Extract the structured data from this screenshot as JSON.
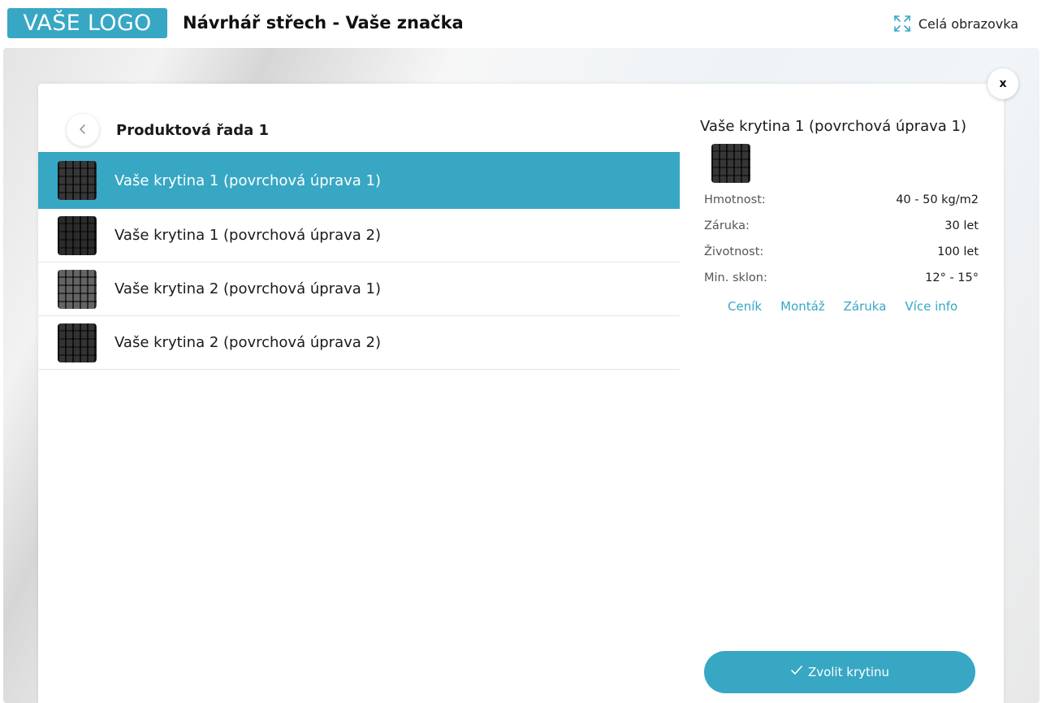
{
  "header": {
    "logo_text": "VAŠE LOGO",
    "app_title": "Návrhář střech - Vaše značka",
    "fullscreen_label": "Celá obrazovka"
  },
  "panel": {
    "close_label": "x",
    "series_title": "Produktová řada 1"
  },
  "products": [
    {
      "name": "Vaše krytina 1 (povrchová úprava 1)",
      "selected": true
    },
    {
      "name": "Vaše krytina 1 (povrchová úprava 2)",
      "selected": false
    },
    {
      "name": "Vaše krytina 2 (povrchová úprava 1)",
      "selected": false
    },
    {
      "name": "Vaše krytina 2 (povrchová úprava 2)",
      "selected": false
    }
  ],
  "detail": {
    "title": "Vaše krytina 1 (povrchová úprava 1)",
    "properties": [
      {
        "label": "Hmotnost:",
        "value": "40 - 50 kg/m2"
      },
      {
        "label": "Záruka:",
        "value": "30 let"
      },
      {
        "label": "Životnost:",
        "value": "100 let"
      },
      {
        "label": "Min. sklon:",
        "value": "12° - 15°"
      }
    ],
    "links": [
      "Ceník",
      "Montáž",
      "Záruka",
      "Více info"
    ],
    "choose_button": "Zvolit krytinu"
  },
  "colors": {
    "accent": "#37a7c4"
  },
  "icons": {
    "fullscreen": "expand-icon",
    "back": "chevron-left-icon",
    "check": "check-icon"
  }
}
